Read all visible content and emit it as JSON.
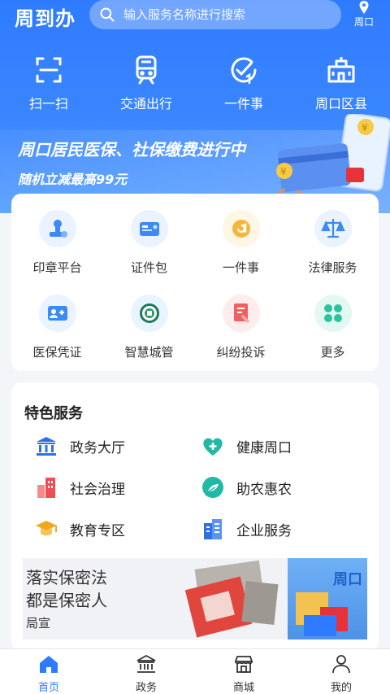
{
  "header": {
    "brand": "周到办",
    "search_placeholder": "输入服务名称进行搜索",
    "location": "周口"
  },
  "quick_actions": [
    {
      "label": "扫一扫",
      "icon": "scan-icon"
    },
    {
      "label": "交通出行",
      "icon": "train-icon"
    },
    {
      "label": "一件事",
      "icon": "one-thing-icon"
    },
    {
      "label": "周口区县",
      "icon": "building-icon"
    }
  ],
  "banner": {
    "title": "周口居民医保、社保缴费进行中",
    "subtitle": "随机立减最高99元"
  },
  "services": [
    {
      "label": "印章平台",
      "icon": "seal-icon",
      "color": "#3b8af7"
    },
    {
      "label": "证件包",
      "icon": "id-card-icon",
      "color": "#3b8af7"
    },
    {
      "label": "一件事",
      "icon": "one-thing-icon",
      "color": "#f5b63a"
    },
    {
      "label": "法律服务",
      "icon": "scales-icon",
      "color": "#3b8af7"
    },
    {
      "label": "医保凭证",
      "icon": "medical-card-icon",
      "color": "#3b8af7"
    },
    {
      "label": "智慧城管",
      "icon": "city-emblem-icon",
      "color": "#2e9a6b"
    },
    {
      "label": "纠纷投诉",
      "icon": "complaint-icon",
      "color": "#f06060"
    },
    {
      "label": "更多",
      "icon": "more-icon",
      "color": "#2cc3a0"
    }
  ],
  "featured": {
    "title": "特色服务",
    "items": [
      {
        "label": "政务大厅",
        "icon": "government-hall-icon",
        "color": "#2f6fe8"
      },
      {
        "label": "健康周口",
        "icon": "health-heart-icon",
        "color": "#23b8a6"
      },
      {
        "label": "社会治理",
        "icon": "city-buildings-icon",
        "color": "#ef4e55"
      },
      {
        "label": "助农惠农",
        "icon": "agriculture-icon",
        "color": "#23b8a6"
      },
      {
        "label": "教育专区",
        "icon": "graduation-cap-icon",
        "color": "#f2a81d"
      },
      {
        "label": "企业服务",
        "icon": "enterprise-icon",
        "color": "#2f6fe8"
      }
    ]
  },
  "ad": {
    "line1": "落实保密法",
    "line2": "都是保密人",
    "line3": "局宣",
    "right_text": "周口"
  },
  "tabbar": [
    {
      "label": "首页",
      "icon": "home-icon",
      "active": true
    },
    {
      "label": "政务",
      "icon": "government-icon",
      "active": false
    },
    {
      "label": "商城",
      "icon": "store-icon",
      "active": false
    },
    {
      "label": "我的",
      "icon": "profile-icon",
      "active": false
    }
  ],
  "colors": {
    "primary": "#2f7bff"
  }
}
